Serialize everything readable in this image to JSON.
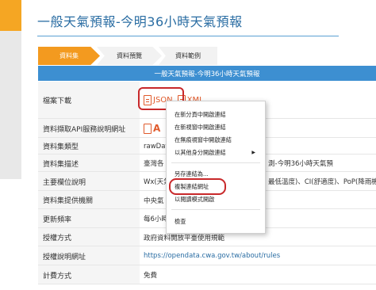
{
  "page": {
    "title": "一般天氣預報-今明36小時天氣預報"
  },
  "tabs": [
    {
      "label": "資料集"
    },
    {
      "label": "資料預覽"
    },
    {
      "label": "資料範例"
    }
  ],
  "table": {
    "header": "一般天氣預報-今明36小時天氣預報",
    "rows": [
      {
        "label": "檔案下載",
        "value": ""
      },
      {
        "label": "資料擷取API服務說明網址",
        "value": ""
      },
      {
        "label": "資料集類型",
        "value": "rawDat"
      },
      {
        "label": "資料集描述",
        "value": "臺灣各"
      },
      {
        "label": "主要欄位說明",
        "value": "Wx(天氣"
      },
      {
        "label": "資料集提供機關",
        "value": "中央氣"
      },
      {
        "label": "更新頻率",
        "value": "每6小時"
      },
      {
        "label": "授權方式",
        "value": "政府資料開放平臺使用規範"
      },
      {
        "label": "授權說明網址",
        "value": "https://opendata.cwa.gov.tw/about/rules"
      },
      {
        "label": "計費方式",
        "value": "免費"
      }
    ],
    "download": {
      "json": "JSON",
      "xml": "XML"
    },
    "desc_tail": "測-今明36小時天氣預",
    "fields_tail": "最低溫度)、CI(舒適度)、PoP(降雨機率",
    "api_icon_text": "A"
  },
  "context_menu": {
    "items": [
      {
        "label": "在新分頁中開啟連結",
        "submenu": false
      },
      {
        "label": "在新視窗中開啟連結",
        "submenu": false
      },
      {
        "label": "在無痕視窗中開啟連結",
        "submenu": false
      },
      {
        "label": "以其他身分開啟連結",
        "submenu": true
      },
      {
        "label": "另存連結為...",
        "submenu": false
      },
      {
        "label": "複製連結網址",
        "submenu": false
      },
      {
        "label": "以閱讀模式開啟",
        "submenu": false
      },
      {
        "label": "檢查",
        "submenu": false
      }
    ],
    "submenu_arrow": "▶"
  },
  "colors": {
    "accent": "#f39a1f",
    "header": "#3d8fd1",
    "title": "#2a6da3",
    "highlight": "#c8282a"
  }
}
